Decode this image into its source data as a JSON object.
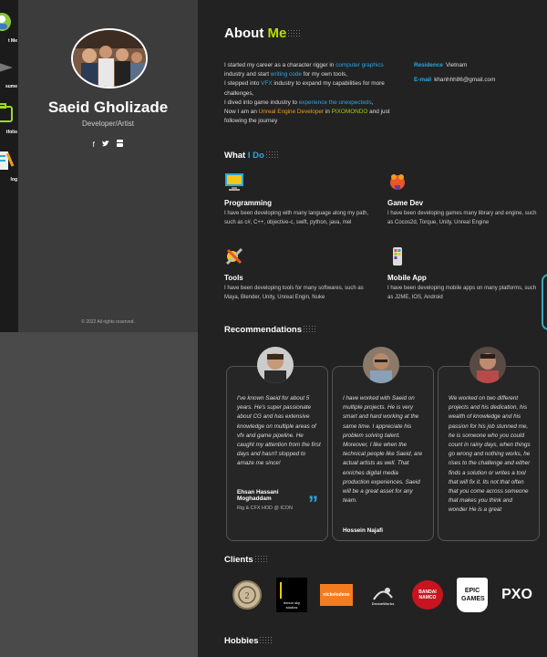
{
  "nav": {
    "items": [
      {
        "label": "t Me",
        "icon": "about-me-icon"
      },
      {
        "label": "sume",
        "icon": "resume-icon"
      },
      {
        "label": "tfolio",
        "icon": "portfolio-icon"
      },
      {
        "label": "log",
        "icon": "blog-icon"
      }
    ]
  },
  "profile": {
    "name": "Saeid Gholizade",
    "role": "Developer/Artist",
    "social": [
      "f",
      "twitter",
      "youtube"
    ],
    "copyright": "© 2022 All rights reserved."
  },
  "about": {
    "title_white": "About",
    "title_green": "Me",
    "lines": {
      "a1": "I started my career as a character rigger in ",
      "a2": "computer graphics",
      "a3": " industry and start ",
      "a4": "writing code",
      "a5": " for my own tools,",
      "b1": "I stepped into ",
      "b2": "VFX",
      "b3": " industry to expand my capabilities for more challenges,",
      "c1": "I dived into game industry to ",
      "c2": "experience the unexpecteds",
      "c3": ",",
      "d1": "Now I am an ",
      "d2": "Unreal Engine Developer",
      "d3": " in ",
      "d4": "PIXOMONDO",
      "d5": " and just following the journey"
    },
    "residence_label": "Residence",
    "residence_value": "Vietnam",
    "email_label": "E-mail",
    "email_value": "khanhhh86@gmail.com"
  },
  "whatido": {
    "title_white": "What",
    "title_blue": "I Do",
    "services": [
      {
        "title": "Programming",
        "icon": "programming-icon",
        "desc": "I have been developing with many language along my path, such as c#, C++, objective-c, swift, python, java, mel"
      },
      {
        "title": "Game Dev",
        "icon": "game-dev-icon",
        "desc": "I have been developing games many library and engine, such as Cocos2d, Torque, Unity, Unreal Engine"
      },
      {
        "title": "Tools",
        "icon": "tools-icon",
        "desc": "I have been developing tools for many softwares, such as Maya, Blender, Unity, Unreal Engin, Nuke"
      },
      {
        "title": "Mobile App",
        "icon": "mobile-app-icon",
        "desc": "I have been developing mobile apps on many platforms, such as J2ME, IOS, Android"
      }
    ]
  },
  "recommendations": {
    "title": "Recommendations",
    "cards": [
      {
        "quote": "I've known Saeid for about 5 years. He's super passionate about CG and has extensive knowledge on multiple areas of vfx and game pipeline. He caught my attention from the first days and hasn't stopped to amaze me since!",
        "name": "Ehsan Hassani Moghaddam",
        "role": "Rig & CFX HOD @ ICON"
      },
      {
        "quote": "I have worked with Saeid on multiple projects. He is very smart and hard working at the same time. I appreciate his problem solving talent. Moreover, I like when the technical people like Saeid, are actual artists as well. That enriches digital media production experiences. Saeid will be a great asset for any team.",
        "name": "Hossein Najafi",
        "role": ""
      },
      {
        "quote": "We worked on two different projects and his dedication, his wealth of knowledge and his passion for his job stunned me, he is someone who you could count in rainy days, when things go wrong and nothing works, he rises to the challenge and either finds a solution or writes a tool that will fix it. Its not that often that you come across someone that makes you think and wonder He is a great",
        "name": "",
        "role": ""
      }
    ]
  },
  "clients": {
    "title": "Clients",
    "logos": [
      {
        "name": "circle-seal-logo",
        "text": ""
      },
      {
        "name": "lemon-sky-logo",
        "text": "lemon sky studios"
      },
      {
        "name": "nickelodeon-logo",
        "text": "nickelodeon"
      },
      {
        "name": "dreamworks-logo",
        "text": "DreamWorks"
      },
      {
        "name": "bandai-namco-logo",
        "text": "BANDAI NAMCO"
      },
      {
        "name": "epic-games-logo",
        "text": "EPIC GAMES"
      },
      {
        "name": "pixomondo-logo",
        "text": "PXO"
      }
    ]
  },
  "hobbies": {
    "title": "Hobbies"
  }
}
